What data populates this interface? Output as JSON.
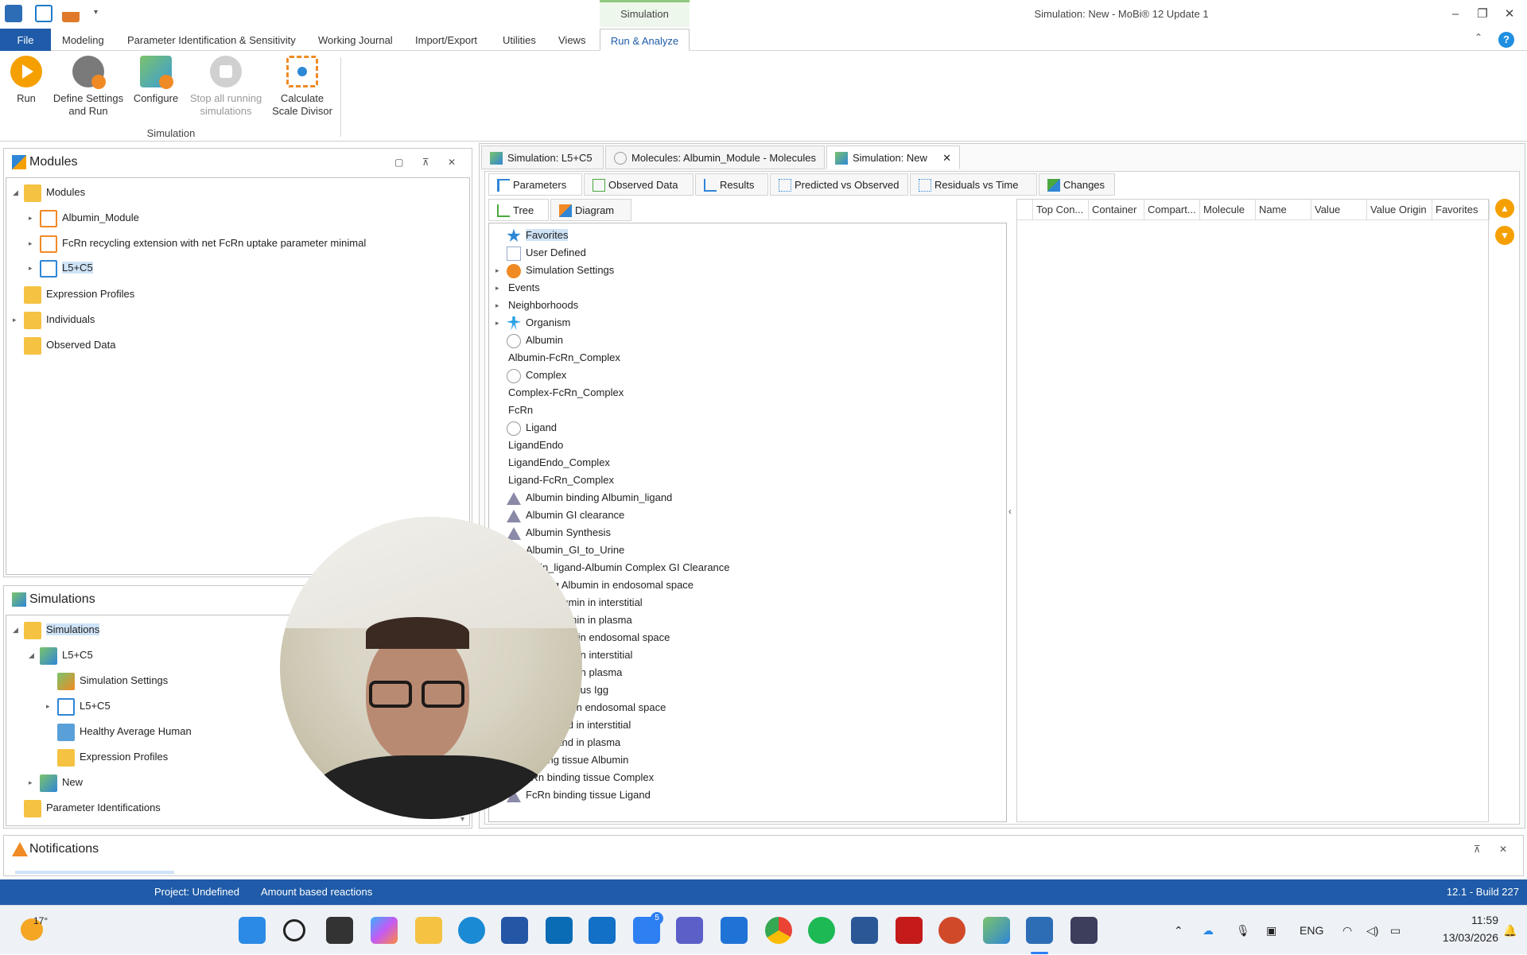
{
  "window": {
    "title": "Simulation: New - MoBi® 12 Update 1",
    "context_tab": "Simulation",
    "controls": [
      "–",
      "❐",
      "✕"
    ]
  },
  "menu": {
    "items": [
      "File",
      "Modeling",
      "Parameter Identification & Sensitivity",
      "Working Journal",
      "Import/Export",
      "Utilities",
      "Views",
      "Run & Analyze"
    ],
    "active": "Run & Analyze"
  },
  "ribbon": {
    "buttons": [
      {
        "label": "Run",
        "icon": "run-icon"
      },
      {
        "label": "Define Settings and Run",
        "icon": "define-settings-icon"
      },
      {
        "label": "Configure",
        "icon": "configure-icon"
      },
      {
        "label": "Stop all running simulations",
        "icon": "stop-icon",
        "disabled": true
      },
      {
        "label": "Calculate Scale Divisor",
        "icon": "scale-divisor-icon"
      }
    ],
    "group_label": "Simulation"
  },
  "modules_panel": {
    "title": "Modules",
    "items": [
      {
        "label": "Modules"
      },
      {
        "label": "Albumin_Module"
      },
      {
        "label": "FcRn recycling extension with net FcRn uptake parameter minimal"
      },
      {
        "label": "L5+C5"
      },
      {
        "label": "Expression Profiles"
      },
      {
        "label": "Individuals"
      },
      {
        "label": "Observed Data"
      }
    ]
  },
  "simulations_panel": {
    "title": "Simulations",
    "items": [
      {
        "label": "Simulations"
      },
      {
        "label": "L5+C5"
      },
      {
        "label": "Simulation Settings"
      },
      {
        "label": "L5+C5"
      },
      {
        "label": "Healthy Average Human"
      },
      {
        "label": "Expression Profiles"
      },
      {
        "label": "New"
      },
      {
        "label": "Parameter Identifications"
      }
    ]
  },
  "notifications": {
    "title": "Notifications"
  },
  "doc_tabs": [
    {
      "label": "Simulation: L5+C5"
    },
    {
      "label": "Molecules: Albumin_Module - Molecules"
    },
    {
      "label": "Simulation: New",
      "active": true
    }
  ],
  "sub_tabs": [
    "Parameters",
    "Observed Data",
    "Results",
    "Predicted vs Observed",
    "Residuals vs Time",
    "Changes"
  ],
  "view_tabs": [
    "Tree",
    "Diagram"
  ],
  "param_tree": [
    "Favorites",
    "User Defined",
    "Simulation Settings",
    "Events",
    "Neighborhoods",
    "Organism",
    "Albumin",
    "Albumin-FcRn_Complex",
    "Complex",
    "Complex-FcRn_Complex",
    "FcRn",
    "Ligand",
    "LigandEndo",
    "LigandEndo_Complex",
    "Ligand-FcRn_Complex",
    "Albumin binding Albumin_ligand",
    "Albumin GI clearance",
    "Albumin Synthesis",
    "Albumin_GI_to_Urine",
    "umin_ligand-Albumin Complex GI Clearance",
    "binding Albumin in endosomal space",
    "ding Albumin in interstitial",
    "ding Albumin in plasma",
    "g Complex in endosomal space",
    "g Complex in interstitial",
    "g Complex in plasma",
    "g endogenous Igg",
    "ng Ligand in endosomal space",
    "ing Ligand in interstitial",
    "ing Ligand in plasma",
    "binding tissue Albumin",
    "cRn binding tissue Complex",
    "FcRn binding tissue Ligand"
  ],
  "grid_columns": [
    "Top Con...",
    "Container",
    "Compart...",
    "Molecule",
    "Name",
    "Value",
    "Value Origin",
    "Favorites"
  ],
  "status": {
    "project": "Project: Undefined",
    "mode": "Amount based reactions",
    "build": "12.1 - Build 227"
  },
  "taskbar": {
    "weather": "17°",
    "lang": "ENG",
    "time": "11:59",
    "date": "13/03/2026",
    "badge_todo": "5"
  }
}
